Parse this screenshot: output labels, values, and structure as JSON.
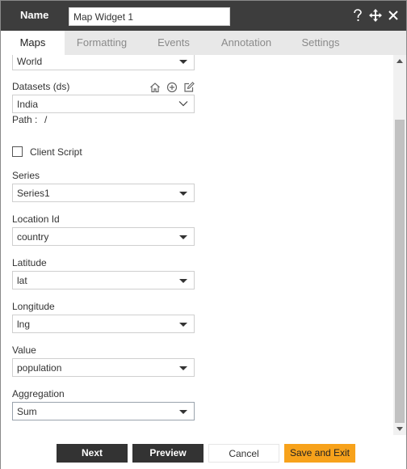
{
  "header": {
    "name_label": "Name",
    "widget_name": "Map Widget 1",
    "help_icon": "question-icon",
    "move_icon": "move-icon",
    "close_icon": "close-icon"
  },
  "tabs": [
    {
      "label": "Maps",
      "active": true
    },
    {
      "label": "Formatting",
      "active": false
    },
    {
      "label": "Events",
      "active": false
    },
    {
      "label": "Annotation",
      "active": false
    },
    {
      "label": "Settings",
      "active": false
    }
  ],
  "form": {
    "map_select": "World",
    "datasets": {
      "label": "Datasets (ds)",
      "value": "India",
      "icons": [
        "home-icon",
        "add-circle-icon",
        "edit-icon"
      ]
    },
    "path_label": "Path :",
    "path_value": "/",
    "client_script_label": "Client Script",
    "client_script_checked": false,
    "series": {
      "label": "Series",
      "value": "Series1"
    },
    "location_id": {
      "label": "Location Id",
      "value": "country"
    },
    "latitude": {
      "label": "Latitude",
      "value": "lat"
    },
    "longitude": {
      "label": "Longitude",
      "value": "lng"
    },
    "value": {
      "label": "Value",
      "value": "population"
    },
    "aggregation": {
      "label": "Aggregation",
      "value": "Sum"
    }
  },
  "footer": {
    "next": "Next",
    "preview": "Preview",
    "cancel": "Cancel",
    "save_exit": "Save and Exit"
  },
  "colors": {
    "titlebar": "#3d3d3d",
    "tabbar": "#e8e8e8",
    "primary_button": "#333333",
    "save_button": "#f7a21b"
  }
}
